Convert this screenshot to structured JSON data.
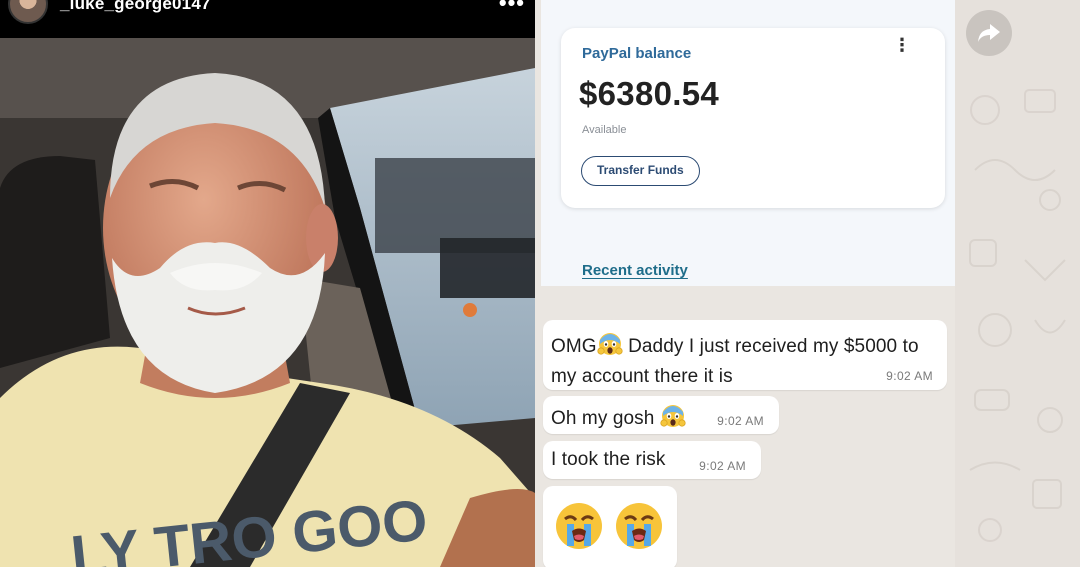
{
  "post": {
    "username": "_luke_george0147",
    "more_glyph": "•••",
    "shirt_text": "LY TRO GOO"
  },
  "paypal": {
    "label": "PayPal balance",
    "amount": "$6380.54",
    "sub": "Available",
    "transfer_button": "Transfer Funds",
    "recent_link": "Recent activity",
    "kebab_glyph": "⋮"
  },
  "chat": {
    "messages": [
      {
        "text_before": "OMG",
        "text_after": " Daddy I just received my $5000 to my account there it is",
        "time": "9:02 AM"
      },
      {
        "text": "Oh my gosh",
        "time": "9:02 AM"
      },
      {
        "text": "I took the risk",
        "time": "9:02 AM"
      }
    ]
  },
  "icons": {
    "forward": "forward-arrow-icon",
    "scream_emoji": "face-screaming-in-fear-emoji",
    "crying_emoji": "loudly-crying-face-emoji"
  },
  "colors": {
    "paypal_label": "#2f6a9a",
    "transfer_border": "#2c4b73",
    "recent_link": "#1f6d8a",
    "chat_wallpaper": "#e6e1dc",
    "bubble": "#ffffff"
  }
}
